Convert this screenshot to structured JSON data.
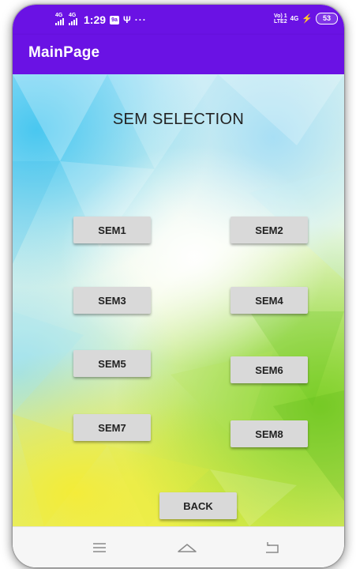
{
  "status_bar": {
    "signal_1": "4G",
    "signal_2": "4G",
    "time": "1:29",
    "app_badge": "9a",
    "usb": "Ψ",
    "more": "···",
    "volte_top": "Vo) 1",
    "volte_bottom": "LTE2",
    "network": "4G",
    "battery": "53"
  },
  "app_bar": {
    "title": "MainPage"
  },
  "screen": {
    "heading": "SEM SELECTION",
    "buttons": [
      "SEM1",
      "SEM2",
      "SEM3",
      "SEM4",
      "SEM5",
      "SEM6",
      "SEM7",
      "SEM8"
    ],
    "back": "BACK"
  },
  "colors": {
    "accent": "#6a12e4",
    "button_bg": "#d9d9d9",
    "nav_bg": "#f6f6f6"
  },
  "icons": {
    "nav": [
      "menu-lines-icon",
      "home-icon",
      "back-return-icon"
    ]
  }
}
